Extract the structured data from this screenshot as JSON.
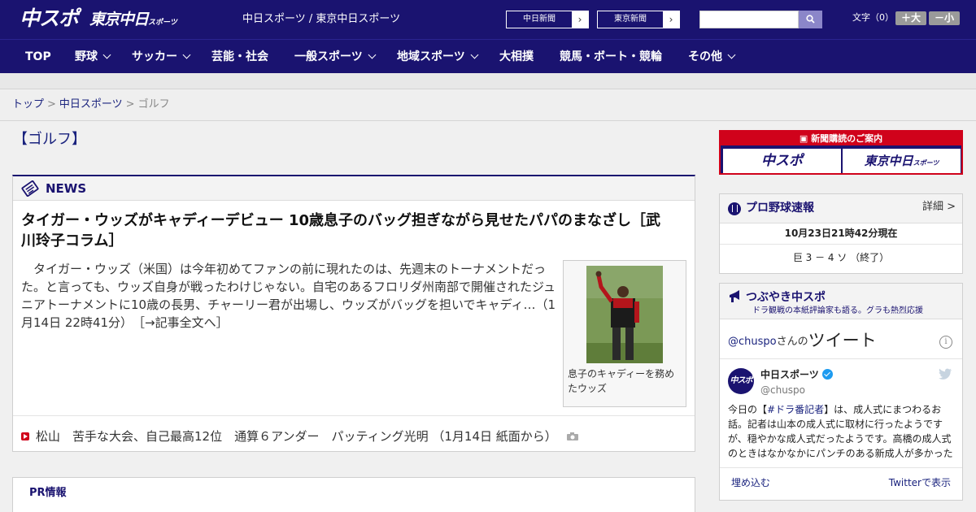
{
  "header": {
    "logo_chuspo": "中スポ",
    "logo_tokyo": "東京中日",
    "logo_tokyo_small": "スポーツ",
    "site_names": "中日スポーツ / 東京中日スポーツ",
    "ext_links": [
      {
        "label": "中日新聞"
      },
      {
        "label": "東京新聞"
      }
    ],
    "search": {
      "value": "",
      "placeholder": ""
    },
    "fontsize_label": "文字（0）",
    "fontsize_large": "＋大",
    "fontsize_small": "－小",
    "icons": {
      "search": "search-icon",
      "arrow": "chevron-right-icon"
    }
  },
  "nav": {
    "items": [
      {
        "label": "TOP"
      },
      {
        "label": "野球"
      },
      {
        "label": "サッカー"
      },
      {
        "label": "芸能・社会"
      },
      {
        "label": "一般スポーツ"
      },
      {
        "label": "地域スポーツ"
      },
      {
        "label": "大相撲"
      },
      {
        "label": "競馬・ボート・競輪"
      },
      {
        "label": "その他"
      }
    ]
  },
  "breadcrumb": {
    "top": "トップ",
    "sep": ">",
    "parent": "中日スポーツ",
    "current": "ゴルフ"
  },
  "page": {
    "title": "【ゴルフ】"
  },
  "news": {
    "section_label": "NEWS",
    "headline": "タイガー・ウッズがキャディーデビュー 10歳息子のバッグ担ぎながら見せたパパのまなざし［武川玲子コラム］",
    "summary": "　タイガー・ウッズ（米国）は今年初めてファンの前に現れたのは、先週末のトーナメントだった。と言っても、ウッズ自身が戦ったわけじゃない。自宅のあるフロリダ州南部で開催されたジュニアトーナメントに10歳の長男、チャーリー君が出場し、ウッズがバッグを担いでキャディ…（1月14日 22時41分）",
    "more": "［→記事全文へ］",
    "photo_caption": "息子のキャディーを務めたウッズ",
    "sub_item": "松山　苦手な大会、自己最高12位　通算６アンダー　パッティング光明 （1月14日 紙面から）"
  },
  "pr": {
    "label": "PR情報"
  },
  "sidebar": {
    "subscribe_bar": "新聞購読のご案内",
    "subscribe_b1": "中スポ",
    "subscribe_b2": "東京中日",
    "subscribe_b2_small": "スポーツ",
    "baseball": {
      "title": "プロ野球速報",
      "link": "詳細 >",
      "timestamp": "10月23日21時42分現在",
      "score": "巨 3 － 4 ソ （終了）"
    },
    "twitter": {
      "title": "つぶやき中スポ",
      "subtitle": "ドラ観戦の本紙評論家も語る。グラも熱烈応援",
      "handle": "@chuspo",
      "handle_suffix": "さんの",
      "tweets_label": "ツイート",
      "name": "中日スポーツ",
      "at": "@chuspo",
      "text_pre": "今日の【",
      "tag": "#ドラ番記者",
      "text_post": "】は、成人式にまつわるお話。記者は山本の成人式に取材に行ったようですが、穏やかな成人式だったようです。高橋の成人式のときはなかなかにパンチのある新成人が多かった",
      "embed": "埋め込む",
      "view_on": "Twitterで表示"
    }
  },
  "colors": {
    "brand": "#1a1370",
    "accent": "#d0021b",
    "link": "#1a237e"
  }
}
